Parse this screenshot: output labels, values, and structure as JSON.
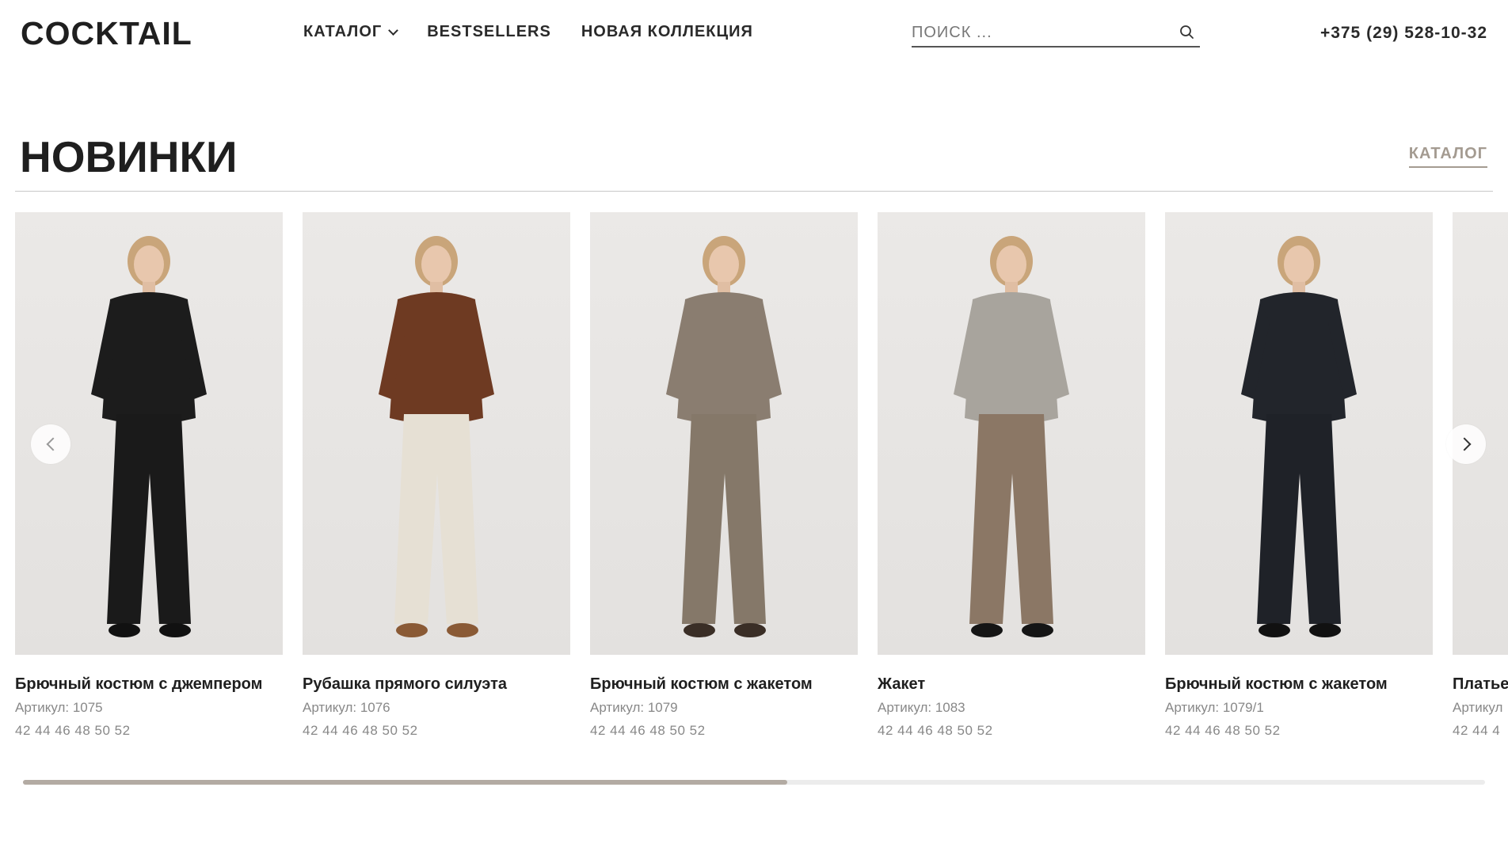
{
  "header": {
    "logo": "COCKTAIL",
    "nav": [
      {
        "label": "КАТАЛОГ",
        "has_dropdown": true
      },
      {
        "label": "BESTSELLERS"
      },
      {
        "label": "НОВАЯ КОЛЛЕКЦИЯ"
      }
    ],
    "search": {
      "placeholder": "ПОИСК ..."
    },
    "phone": "+375 (29) 528-10-32"
  },
  "section": {
    "title": "НОВИНКИ",
    "catalog_link": "КАТАЛОГ"
  },
  "products": [
    {
      "title": "Брючный костюм с джемпером",
      "sku": "Артикул: 1075",
      "sizes": "42 44 46 48 50 52",
      "top": "#1c1c1c",
      "bottom": "#1a1a1a",
      "shoes": "#111111"
    },
    {
      "title": "Рубашка прямого силуэта",
      "sku": "Артикул: 1076",
      "sizes": "42 44 46 48 50 52",
      "top": "#6e3a22",
      "bottom": "#e6e0d4",
      "shoes": "#8a5a35"
    },
    {
      "title": "Брючный костюм с жакетом",
      "sku": "Артикул: 1079",
      "sizes": "42 44 46 48 50 52",
      "top": "#8a7d70",
      "bottom": "#857869",
      "shoes": "#3a2e26"
    },
    {
      "title": "Жакет",
      "sku": "Артикул: 1083",
      "sizes": "42 44 46 48 50 52",
      "top": "#a8a49d",
      "bottom": "#8b7765",
      "shoes": "#151515"
    },
    {
      "title": "Брючный костюм с жакетом",
      "sku": "Артикул: 1079/1",
      "sizes": "42 44 46 48 50 52",
      "top": "#22252b",
      "bottom": "#1f2228",
      "shoes": "#111111"
    },
    {
      "title": "Платье",
      "sku": "Артикул",
      "sizes": "42 44 4",
      "top": "#e0dedb",
      "bottom": "#e0dedb",
      "shoes": "#e0dedb"
    }
  ],
  "scroll": {
    "position": 0.523
  },
  "colors": {
    "accent": "#a49b91",
    "text": "#1f1f1f",
    "muted": "#888888"
  }
}
